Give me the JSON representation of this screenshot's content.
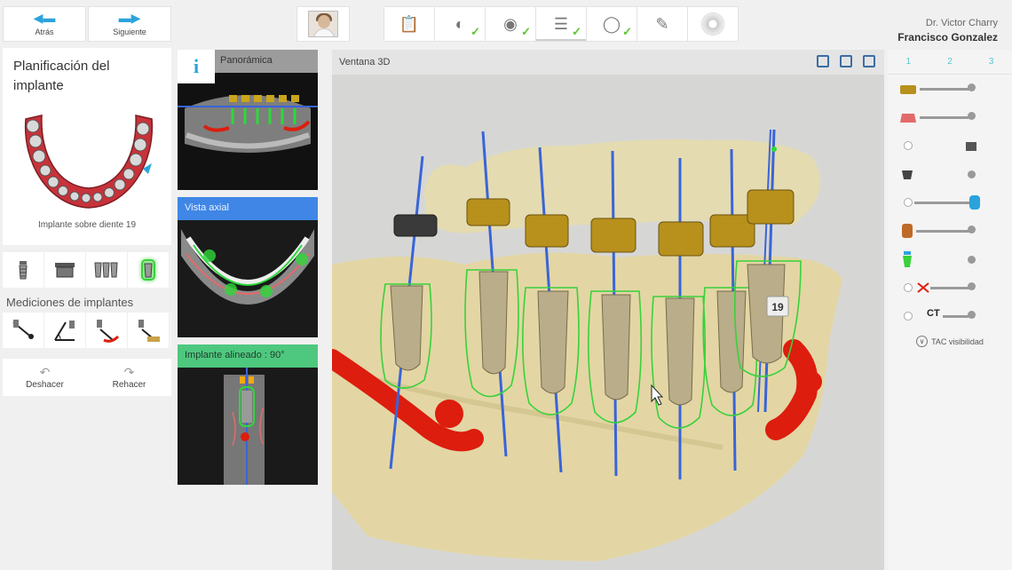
{
  "nav": {
    "back_label": "Atrás",
    "next_label": "Siguiente"
  },
  "workflow_steps": [
    {
      "icon": "prescription-icon",
      "done": false
    },
    {
      "icon": "scan-import-icon",
      "done": true
    },
    {
      "icon": "jaw-model-icon",
      "done": true
    },
    {
      "icon": "implant-planning-icon",
      "done": true,
      "active": true
    },
    {
      "icon": "guide-icon",
      "done": true
    },
    {
      "icon": "export-icon",
      "done": false
    },
    {
      "icon": "disc-icon",
      "done": false
    }
  ],
  "doctor": {
    "name": "Dr. Victor Charry",
    "patient": "Francisco Gonzalez"
  },
  "left_panel": {
    "title": "Planificación del implante",
    "caption": "Implante sobre diente 19",
    "measurements_label": "Mediciones de implantes",
    "undo_label": "Deshacer",
    "redo_label": "Rehacer"
  },
  "thumbnails": [
    {
      "title": "Panorámica",
      "header_style": "gray"
    },
    {
      "title": "Vista axial",
      "header_style": "blue"
    },
    {
      "title": "Implante alineado : 90°",
      "header_style": "green"
    }
  ],
  "main_window": {
    "title": "Ventana 3D",
    "tooth_label": "19"
  },
  "right_panel": {
    "tabs": [
      "1",
      "2",
      "3"
    ],
    "ct_label": "CT",
    "tac_label": "TAC visibilidad"
  },
  "colors": {
    "accent_blue": "#2aa3dd",
    "check_green": "#5cc52e",
    "bone": "#e3d6a4",
    "nerve_red": "#dd1d0e",
    "implant_tan": "#b9ad8a",
    "guide_gold": "#b8901c",
    "outline_green": "#38d23a",
    "axis_blue": "#3a64d8"
  }
}
